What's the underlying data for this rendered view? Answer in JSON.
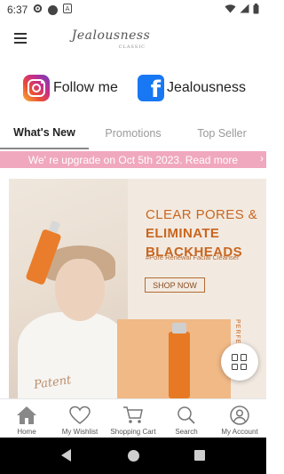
{
  "status_bar": {
    "time": "6:37"
  },
  "app": {
    "brand_main": "Jealousness",
    "brand_sub": "CLASSIC"
  },
  "social": {
    "instagram_label": "Follow me",
    "facebook_label": "Jealousness"
  },
  "tabs": [
    {
      "label": "What's New",
      "active": true
    },
    {
      "label": "Promotions",
      "active": false
    },
    {
      "label": "Top Seller",
      "active": false
    }
  ],
  "banner": {
    "text": "We' re upgrade on Oct 5th 2023. Read more"
  },
  "hero": {
    "headline_line1": "CLEAR PORES &",
    "headline_line2": "ELIMINATE",
    "headline_line3": "BLACKHEADS",
    "tagline": "#Pore Renewal Facial Cleanser",
    "shop_button": "SHOP NOW",
    "side_text": "PERFECT",
    "signature": "Patent"
  },
  "bottom_nav": [
    {
      "label": "Home",
      "icon": "home-icon"
    },
    {
      "label": "My Wishlist",
      "icon": "heart-icon"
    },
    {
      "label": "Shopping Cart",
      "icon": "cart-icon"
    },
    {
      "label": "Search",
      "icon": "search-icon"
    },
    {
      "label": "My Account",
      "icon": "account-icon"
    }
  ],
  "colors": {
    "banner_bg": "#f0a8bf",
    "accent_orange": "#c9661f",
    "facebook_blue": "#1877f2"
  }
}
